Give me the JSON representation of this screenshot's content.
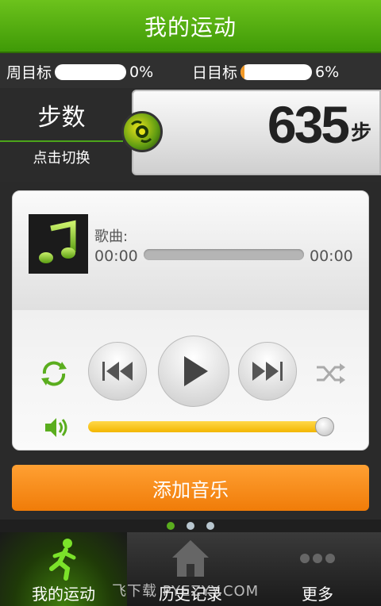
{
  "header": {
    "title": "我的运动"
  },
  "goals": {
    "weekly": {
      "label": "周目标",
      "percent_text": "0%",
      "progress": 0.0
    },
    "daily": {
      "label": "日目标",
      "percent_text": "6%",
      "progress": 0.06
    }
  },
  "steps": {
    "mode_label": "步数",
    "switch_hint": "点击切换",
    "count": "635",
    "unit": "步"
  },
  "player": {
    "song_label": "歌曲:",
    "time_elapsed": "00:00",
    "time_total": "00:00",
    "progress": 0.0,
    "volume": 0.98
  },
  "actions": {
    "add_music": "添加音乐"
  },
  "pager": {
    "pages": 3,
    "active": 0
  },
  "tabs": [
    {
      "label": "我的运动",
      "icon": "runner-icon",
      "active": true
    },
    {
      "label": "历史记录",
      "icon": "house-icon",
      "active": false
    },
    {
      "label": "更多",
      "icon": "more-dots-icon",
      "active": false
    }
  ],
  "watermark": "飞下载  PYEZYY.COM",
  "colors": {
    "brand_green": "#4ca51a",
    "accent_orange": "#f07c08",
    "volume_yellow": "#f3b600"
  }
}
